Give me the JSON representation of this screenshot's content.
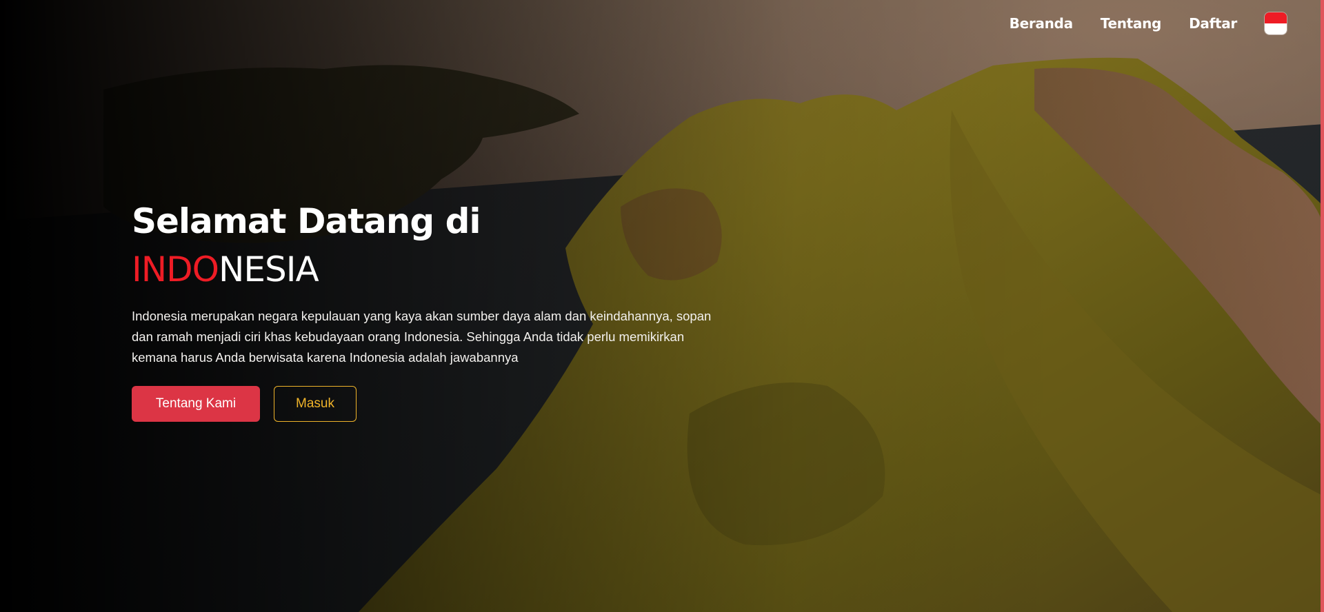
{
  "nav": {
    "items": [
      {
        "label": "Beranda"
      },
      {
        "label": "Tentang"
      },
      {
        "label": "Daftar"
      }
    ],
    "flag_icon": "indonesia-flag-icon",
    "flag_colors": {
      "top": "#ee1c25",
      "bottom": "#ffffff"
    }
  },
  "hero": {
    "headline": "Selamat Datang di",
    "brand_accent": "INDO",
    "brand_rest": "NESIA",
    "description": "Indonesia merupakan negara kepulauan yang kaya akan sumber daya alam dan keindahannya, sopan dan ramah menjadi ciri khas kebudayaan orang Indonesia. Sehingga Anda tidak perlu memikirkan kemana harus Anda berwisata karena Indonesia adalah jawabannya",
    "primary_button": "Tentang Kami",
    "secondary_button": "Masuk"
  },
  "colors": {
    "accent_red": "#ee1c25",
    "button_red": "#dc3545",
    "button_outline": "#f0b42a"
  }
}
